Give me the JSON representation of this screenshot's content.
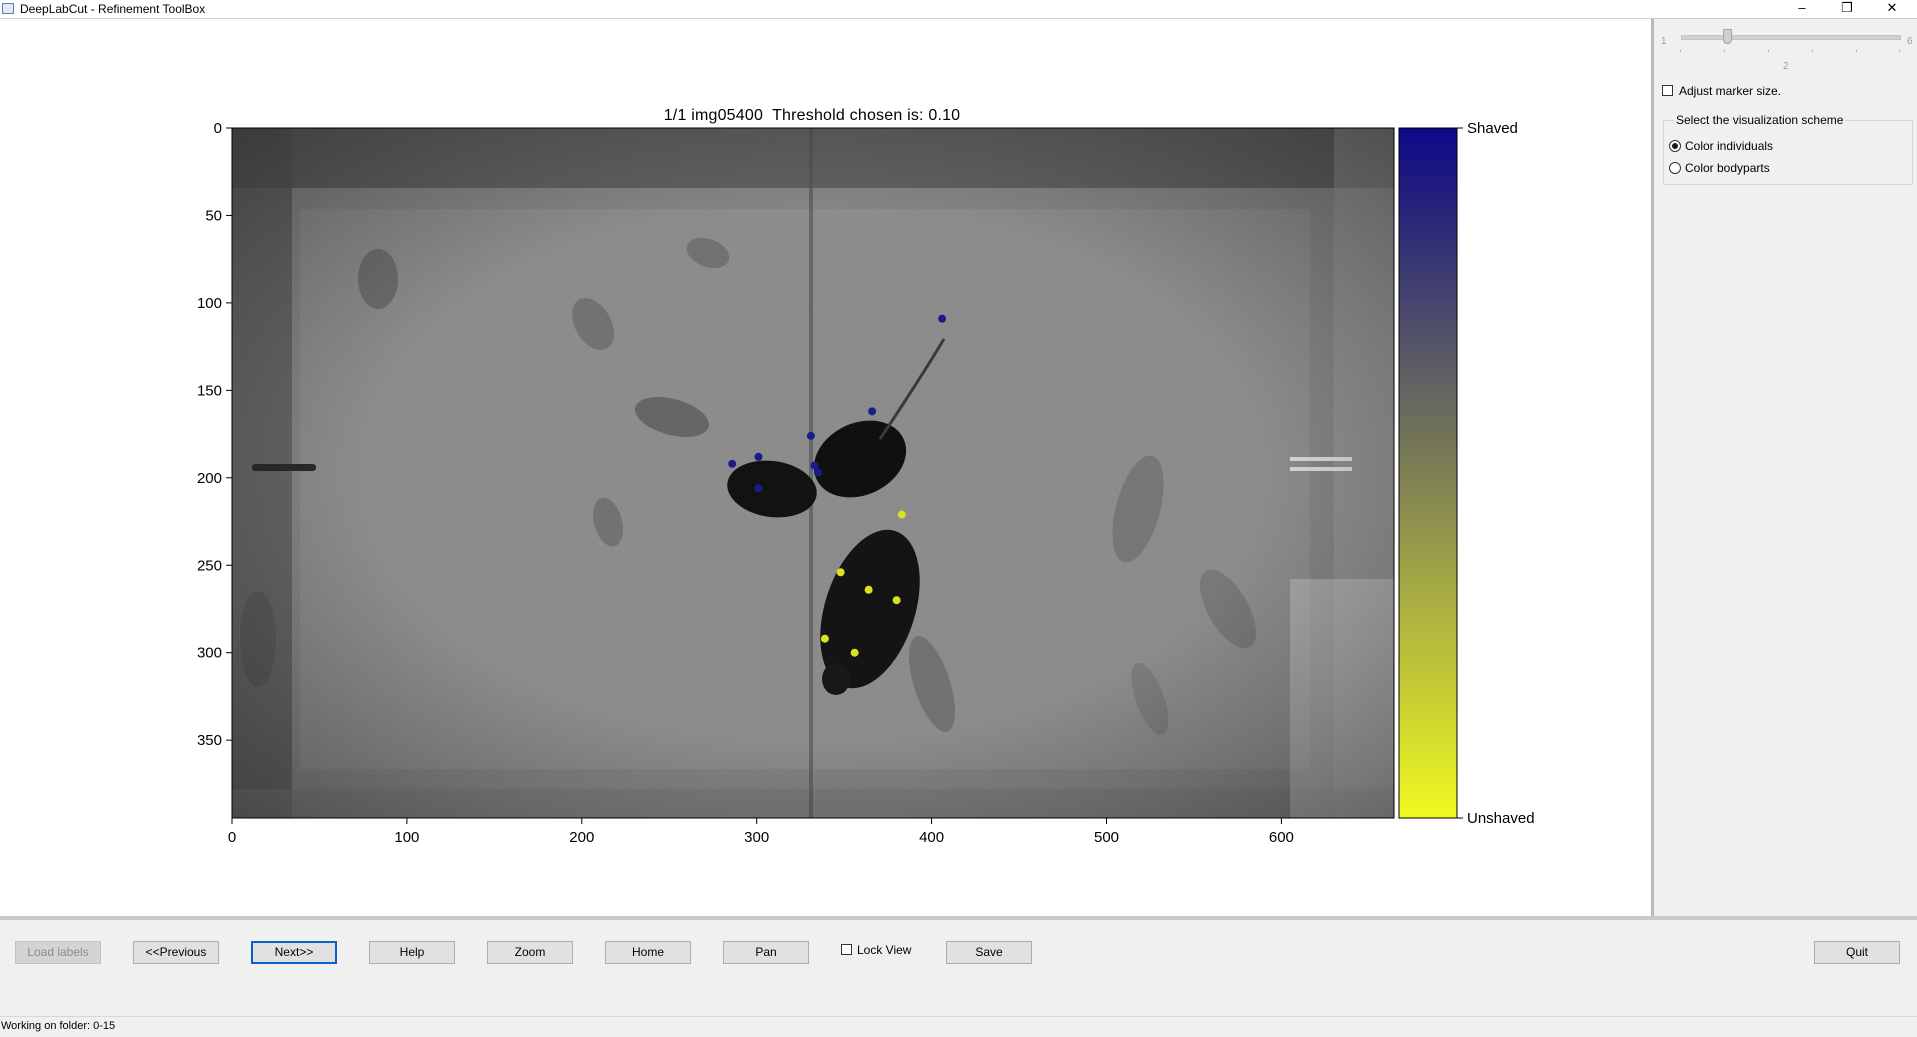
{
  "window": {
    "title": "DeepLabCut - Refinement ToolBox",
    "controls": [
      "–",
      "❐",
      "✕"
    ]
  },
  "plot": {
    "title": "1/1 img05400  Threshold chosen is: 0.10",
    "y_ticks": [
      "0",
      "50",
      "100",
      "150",
      "200",
      "250",
      "300",
      "350"
    ],
    "x_ticks": [
      "0",
      "100",
      "200",
      "300",
      "400",
      "500",
      "600"
    ],
    "colorbar_top_label": "Shaved",
    "colorbar_bottom_label": "Unshaved",
    "colormap": [
      "#0d0887",
      "#5302a3",
      "#8b0aa5",
      "#b83289",
      "#db5c68",
      "#f48849",
      "#febd2a",
      "#f0f921"
    ],
    "individual_colors": {
      "shaved": "#1a1c8c",
      "unshaved": "#d8e21e"
    },
    "keypoints": [
      {
        "individual": "shaved",
        "x": 406,
        "y": 109
      },
      {
        "individual": "shaved",
        "x": 366,
        "y": 162
      },
      {
        "individual": "shaved",
        "x": 331,
        "y": 176
      },
      {
        "individual": "shaved",
        "x": 286,
        "y": 192
      },
      {
        "individual": "shaved",
        "x": 301,
        "y": 188
      },
      {
        "individual": "shaved",
        "x": 333,
        "y": 193
      },
      {
        "individual": "shaved",
        "x": 335,
        "y": 197
      },
      {
        "individual": "shaved",
        "x": 301,
        "y": 206
      },
      {
        "individual": "unshaved",
        "x": 383,
        "y": 221
      },
      {
        "individual": "unshaved",
        "x": 348,
        "y": 254
      },
      {
        "individual": "unshaved",
        "x": 364,
        "y": 264
      },
      {
        "individual": "unshaved",
        "x": 380,
        "y": 270
      },
      {
        "individual": "unshaved",
        "x": 339,
        "y": 292
      },
      {
        "individual": "unshaved",
        "x": 356,
        "y": 300
      }
    ]
  },
  "sidebar": {
    "slider": {
      "min_label": "1",
      "max_label": "6",
      "value_label": "2",
      "value": 2
    },
    "adjust_marker_label": "Adjust marker size.",
    "scheme_group_title": "Select the visualization scheme",
    "options": [
      {
        "label": "Color individuals",
        "selected": true
      },
      {
        "label": "Color bodyparts",
        "selected": false
      }
    ]
  },
  "toolbar": {
    "load_labels": "Load labels",
    "previous": "<<Previous",
    "next": "Next>>",
    "help": "Help",
    "zoom": "Zoom",
    "home": "Home",
    "pan": "Pan",
    "lock_view": "Lock View",
    "save": "Save",
    "quit": "Quit"
  },
  "status": {
    "text": "Working on folder: 0-15"
  }
}
